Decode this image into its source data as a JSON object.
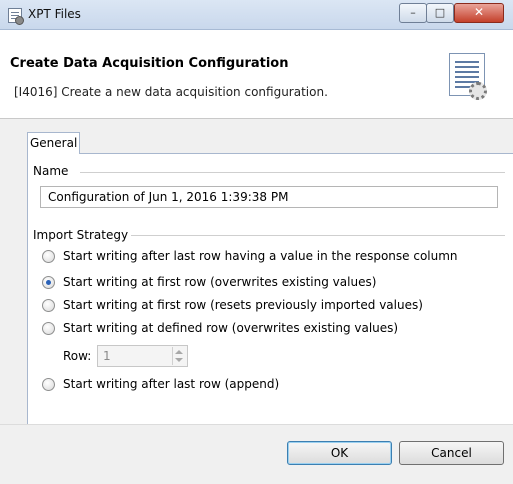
{
  "window": {
    "title": "XPT Files",
    "minimize_glyph": "–",
    "maximize_glyph": "□",
    "close_glyph": "✕"
  },
  "header": {
    "title": "Create Data Acquisition Configuration",
    "description": "[I4016] Create a new data acquisition configuration."
  },
  "tabs": [
    {
      "label": "General",
      "active": true
    }
  ],
  "name_group": {
    "label": "Name",
    "value": "Configuration of Jun 1, 2016 1:39:38 PM"
  },
  "import_strategy": {
    "label": "Import Strategy",
    "options": [
      {
        "label": "Start writing after last row having a value in the response column",
        "checked": false
      },
      {
        "label": "Start writing at first row (overwrites existing values)",
        "checked": true
      },
      {
        "label": "Start writing at first row (resets previously imported values)",
        "checked": false
      },
      {
        "label": "Start writing at defined row (overwrites existing values)",
        "checked": false
      },
      {
        "label": "Start writing after last row (append)",
        "checked": false
      }
    ],
    "row_label": "Row:",
    "row_value": "1"
  },
  "buttons": {
    "ok": "OK",
    "cancel": "Cancel"
  },
  "icons": {
    "app": "xpt-files-icon",
    "banner": "document-gear-icon"
  }
}
